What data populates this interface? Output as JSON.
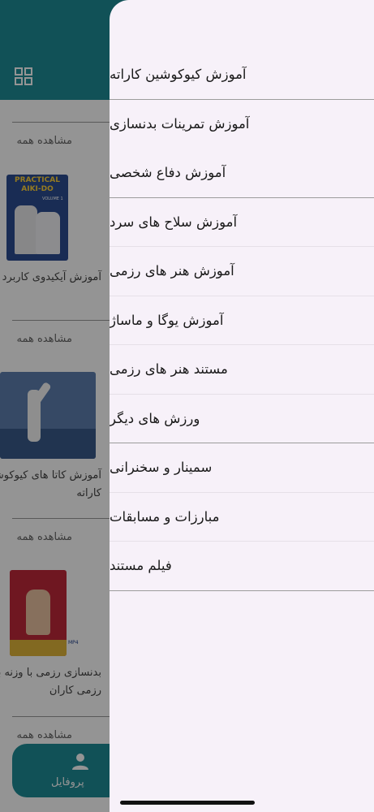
{
  "app": {
    "sections": [
      {
        "see_all": "مشاهده همه",
        "caption": "آموزش آیکیدوی کاربرد",
        "thumb_title": "PRACTICAL AIKI-DO",
        "thumb_subtitle": "VOLUME 1"
      },
      {
        "see_all": "مشاهده همه",
        "caption": "آموزش کاتا های کیوکوشین کاراته"
      },
      {
        "see_all": "مشاهده همه",
        "caption": "بدنسازی رزمی با وزنه برای رزمی کاران",
        "thumb_badge": "MP4"
      },
      {
        "see_all": "مشاهده همه"
      }
    ],
    "bottom_nav": {
      "profile_label": "پروفایل"
    }
  },
  "drawer": {
    "items": [
      "آموزش کیوکوشین کاراته",
      "آموزش تمرینات بدنسازی",
      "آموزش دفاع شخصی",
      "آموزش سلاح های سرد",
      "آموزش هنر های رزمی",
      "آموزش یوگا و ماساژ",
      "مستند هنر های رزمی",
      "ورزش های دیگر",
      "سمینار و سخنرانی",
      "مبارزات و مسابقات",
      "فیلم مستند"
    ]
  },
  "colors": {
    "header": "#1e8c97",
    "drawer_bg": "#f7f1f9",
    "overlay": "rgba(0,0,0,0.42)"
  }
}
